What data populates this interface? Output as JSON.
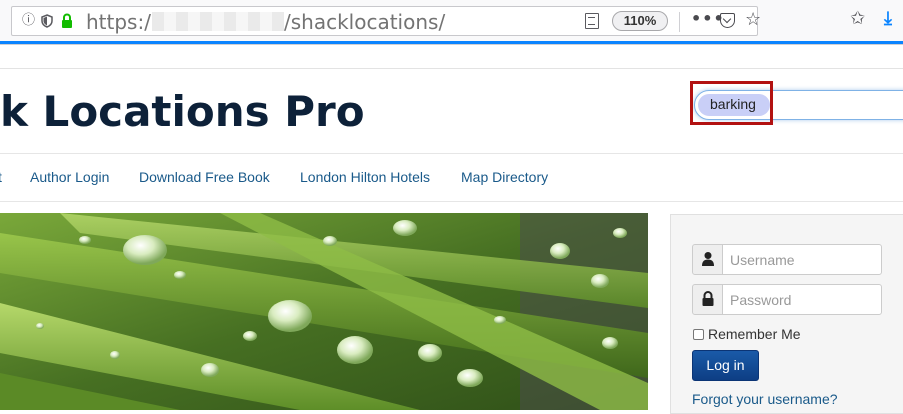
{
  "browser": {
    "url_prefix": "https:/",
    "url_path": "/shacklocations/",
    "zoom": "110%",
    "overflow_menu": "•••",
    "accent_color": "#0a84ff",
    "icons": [
      "info-icon",
      "shield-icon",
      "lock-icon",
      "reader-view-icon",
      "pocket-icon",
      "bookmark-star-icon",
      "library-icon",
      "download-icon"
    ]
  },
  "site": {
    "title": "k Locations Pro",
    "title_color": "#0d2139"
  },
  "search": {
    "value": "barking"
  },
  "nav": {
    "prev_tail": "t",
    "items": [
      {
        "label": "Author Login"
      },
      {
        "label": "Download Free Book"
      },
      {
        "label": "London Hilton Hotels"
      },
      {
        "label": "Map Directory"
      }
    ]
  },
  "login": {
    "username_placeholder": "Username",
    "password_placeholder": "Password",
    "remember_label": "Remember Me",
    "submit_label": "Log in",
    "forgot_label": "Forgot your username?",
    "button_color": "#0d3e84"
  }
}
